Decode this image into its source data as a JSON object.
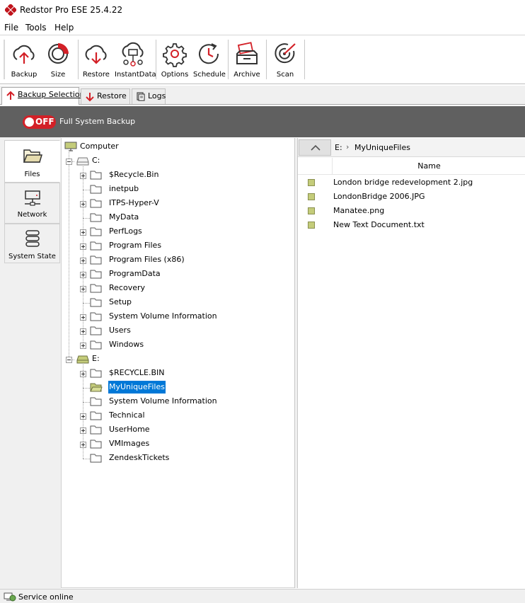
{
  "app": {
    "title": "Redstor Pro ESE 25.4.22"
  },
  "menu": [
    "File",
    "Tools",
    "Help"
  ],
  "toolbar": {
    "backup": "Backup",
    "size": "Size",
    "restore": "Restore",
    "instantdata": "InstantData",
    "options": "Options",
    "schedule": "Schedule",
    "archive": "Archive",
    "scan": "Scan"
  },
  "tabs": {
    "backup_selection": "Backup Selection",
    "restore": "Restore",
    "logs": "Logs"
  },
  "full_system_backup": {
    "toggle": "OFF",
    "label": "Full System Backup"
  },
  "side": {
    "files": "Files",
    "network": "Network",
    "system_state": "System State"
  },
  "tree": {
    "root": "Computer",
    "drive_c": "C:",
    "c_items": [
      "$Recycle.Bin",
      "inetpub",
      "ITPS-Hyper-V",
      "MyData",
      "PerfLogs",
      "Program Files",
      "Program Files (x86)",
      "ProgramData",
      "Recovery",
      "Setup",
      "System Volume Information",
      "Users",
      "Windows"
    ],
    "drive_e": "E:",
    "e_items": [
      "$RECYCLE.BIN",
      "MyUniqueFiles",
      "System Volume Information",
      "Technical",
      "UserHome",
      "VMImages",
      "ZendeskTickets"
    ]
  },
  "path": {
    "drive": "E:",
    "separator": "›",
    "folder": "MyUniqueFiles"
  },
  "file_list": {
    "header_name": "Name",
    "files": [
      "London bridge redevelopment 2.jpg",
      "LondonBridge 2006.JPG",
      "Manatee.png",
      "New Text Document.txt"
    ]
  },
  "status": {
    "text": "Service online"
  },
  "colors": {
    "accent_red": "#d32027",
    "selection_blue": "#0078d7",
    "bar_gray": "#606060",
    "check_olive": "#c4cc7a"
  }
}
